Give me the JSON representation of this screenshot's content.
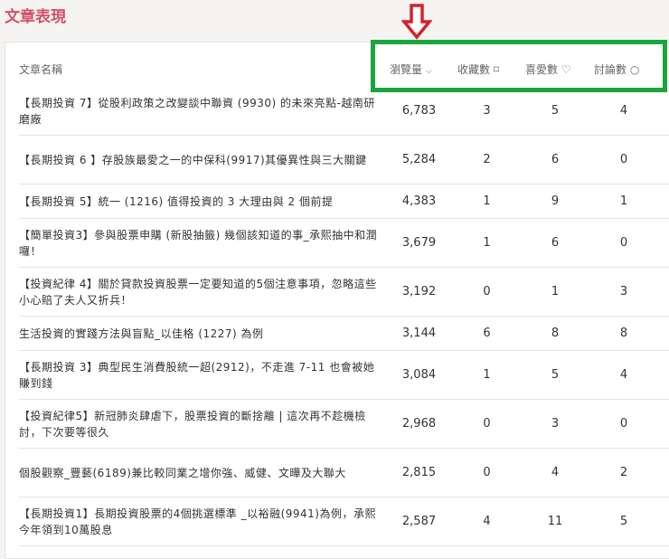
{
  "page_title": "文章表現",
  "header": {
    "name": "文章名稱",
    "views": "瀏覽量",
    "saves": "收藏數",
    "likes": "喜愛數",
    "comments": "討論數"
  },
  "rows": [
    {
      "title": "【長期投資 7】從股利政策之改變談中聯資 (9930) 的未來亮點-越南研磨廠",
      "views": "6,783",
      "saves": "3",
      "likes": "5",
      "comments": "4",
      "lines": 2
    },
    {
      "title": "【長期投資 6 】存股族最愛之一的中保科(9917)其優異性與三大關鍵",
      "views": "5,284",
      "saves": "2",
      "likes": "6",
      "comments": "0",
      "lines": 2
    },
    {
      "title": "【長期投資 5】統一 (1216) 值得投資的 3 大理由與 2 個前提",
      "views": "4,383",
      "saves": "1",
      "likes": "9",
      "comments": "1",
      "lines": 1
    },
    {
      "title": "【簡單投資3】參與股票申購 (新股抽籤) 幾個該知道的事_承熙抽中和潤囉！",
      "views": "3,679",
      "saves": "1",
      "likes": "6",
      "comments": "0",
      "lines": 2
    },
    {
      "title": "【投資紀律 4】關於貸款投資股票一定要知道的5個注意事項，忽略這些小心賠了夫人又折兵！",
      "views": "3,192",
      "saves": "0",
      "likes": "1",
      "comments": "3",
      "lines": 2
    },
    {
      "title": "生活投資的實踐方法與盲點_以佳格 (1227) 為例",
      "views": "3,144",
      "saves": "6",
      "likes": "8",
      "comments": "8",
      "lines": 1
    },
    {
      "title": "【長期投資 3】典型民生消費股統一超(2912)，不走進 7-11 也會被她賺到錢",
      "views": "3,084",
      "saves": "1",
      "likes": "5",
      "comments": "4",
      "lines": 2
    },
    {
      "title": "【投資紀律5】新冠肺炎肆虐下，股票投資的斷捨離 | 這次再不趁機檢討，下次要等很久",
      "views": "2,968",
      "saves": "0",
      "likes": "3",
      "comments": "0",
      "lines": 2
    },
    {
      "title": "個股觀察_豐藝(6189)兼比較同業之增你強、威健、文曄及大聯大",
      "views": "2,815",
      "saves": "0",
      "likes": "4",
      "comments": "2",
      "lines": 2
    },
    {
      "title": "【長期投資1】長期投資股票的4個挑選標準 _以裕融(9941)為例，承熙今年領到10萬股息",
      "views": "2,587",
      "saves": "4",
      "likes": "11",
      "comments": "5",
      "lines": 2
    }
  ],
  "colors": {
    "title": "#d4506a",
    "highlight_box": "#1aa63a",
    "arrow": "#d6222a"
  }
}
